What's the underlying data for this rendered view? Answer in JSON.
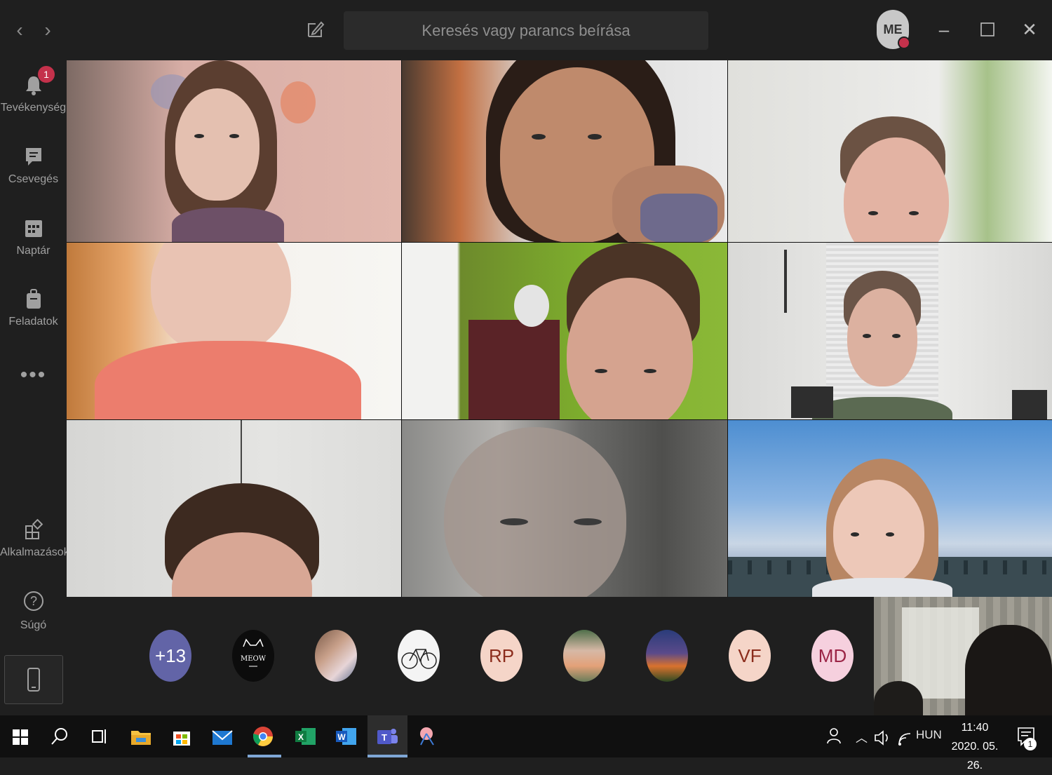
{
  "titlebar": {
    "search_placeholder": "Keresés vagy parancs beírása",
    "user_initials": "ME"
  },
  "rail": {
    "items": [
      {
        "label": "Tevékenység",
        "icon": "bell-icon",
        "badge": "1"
      },
      {
        "label": "Csevegés",
        "icon": "chat-icon"
      },
      {
        "label": "Naptár",
        "icon": "calendar-icon"
      },
      {
        "label": "Feladatok",
        "icon": "briefcase-icon"
      },
      {
        "label": "Alkalmazások",
        "icon": "apps-icon"
      },
      {
        "label": "Súgó",
        "icon": "help-icon"
      }
    ],
    "more": "•••"
  },
  "participants": {
    "overflow": "+13",
    "initials": [
      "RP",
      "VF",
      "MD"
    ],
    "colors": {
      "overflow": "#6264a7",
      "rp": "#f5d5c8",
      "vf": "#f5d5c8",
      "md": "#f6d0de",
      "initials_text": "#8b2c1c",
      "md_text": "#9b2446"
    }
  },
  "taskbar": {
    "language": "HUN",
    "time": "11:40",
    "date": "2020. 05. 26.",
    "notification_count": "1"
  }
}
